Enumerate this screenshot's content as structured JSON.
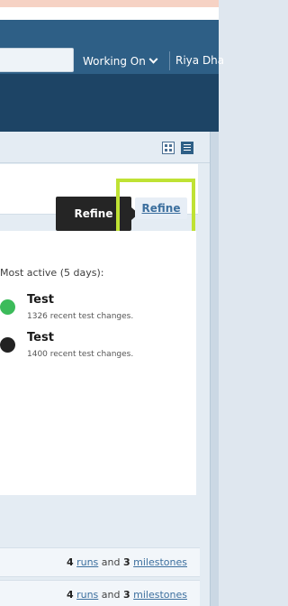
{
  "header": {
    "search_value": "",
    "working_on_label": "Working On",
    "user_name": "Riya Dha"
  },
  "view_icons": [
    "compact-view-icon",
    "detail-view-icon"
  ],
  "tooltip_text": "Refine",
  "refine_label": "Refine",
  "activity": {
    "heading": "Most active (5 days):",
    "projects": [
      {
        "name": "Test",
        "desc": "1326 recent test changes.",
        "color": "#3cbb5a"
      },
      {
        "name": "Test",
        "desc": "1400 recent test changes.",
        "color": "#222222"
      }
    ]
  },
  "rows": [
    {
      "runs_count": "4",
      "runs_label": "runs",
      "and": "and",
      "milestones_count": "3",
      "milestones_label": "milestones"
    },
    {
      "runs_count": "4",
      "runs_label": "runs",
      "and": "and",
      "milestones_count": "3",
      "milestones_label": "milestones"
    }
  ],
  "colors": {
    "header_top": "#2e5f86",
    "header_bottom": "#1d4465",
    "highlight": "#bfe234",
    "link": "#3c6f9e"
  }
}
